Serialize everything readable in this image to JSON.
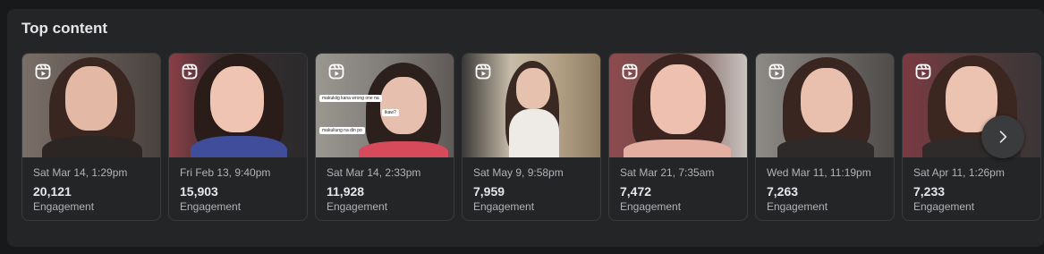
{
  "section": {
    "title": "Top content"
  },
  "cards": [
    {
      "date": "Sat Mar 14, 1:29pm",
      "count": "20,121",
      "metric": "Engagement"
    },
    {
      "date": "Fri Feb 13, 9:40pm",
      "count": "15,903",
      "metric": "Engagement"
    },
    {
      "date": "Sat Mar 14, 2:33pm",
      "count": "11,928",
      "metric": "Engagement",
      "captions": [
        "makukiig kana wrong one na",
        "ikaw?",
        "makuliung na din po"
      ]
    },
    {
      "date": "Sat May 9, 9:58pm",
      "count": "7,959",
      "metric": "Engagement"
    },
    {
      "date": "Sat Mar 21, 7:35am",
      "count": "7,472",
      "metric": "Engagement"
    },
    {
      "date": "Wed Mar 11, 11:19pm",
      "count": "7,263",
      "metric": "Engagement"
    },
    {
      "date": "Sat Apr 11, 1:26pm",
      "count": "7,233",
      "metric": "Engagement"
    }
  ],
  "icons": {
    "reel": "reels-icon",
    "next": "chevron-right-icon"
  },
  "colors": {
    "background": "#18191a",
    "panel": "#242526",
    "card_border": "#3a3b3c",
    "primary_text": "#e4e6eb",
    "secondary_text": "#b0b3b8"
  }
}
